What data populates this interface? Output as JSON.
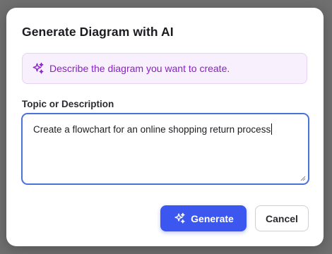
{
  "dialog": {
    "title": "Generate Diagram with AI",
    "hint": {
      "icon": "sparkles-icon",
      "text": "Describe the diagram you want to create."
    },
    "topic_field": {
      "label": "Topic or Description",
      "value": "Create a flowchart for an online shopping return process"
    },
    "buttons": {
      "generate_label": "Generate",
      "generate_icon": "sparkles-icon",
      "cancel_label": "Cancel"
    }
  },
  "colors": {
    "overlay": "#6f6f6f",
    "accent": "#3c57f0",
    "hint_background": "#f8f0fd",
    "hint_text": "#8a1ec7",
    "focus_border": "#4a73d9"
  }
}
